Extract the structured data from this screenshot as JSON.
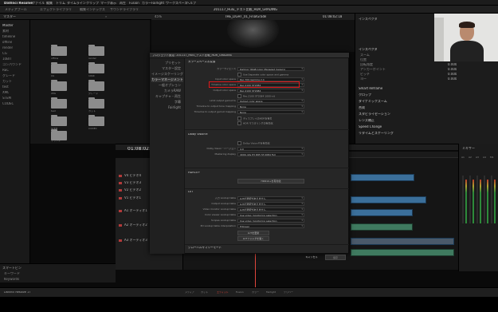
{
  "app": {
    "name": "DaVinci Resolve",
    "menus": [
      "ファイル",
      "編集",
      "トリム",
      "タイムライン",
      "クリップ",
      "マーク",
      "表示",
      "再生",
      "Fusion",
      "カラー",
      "Fairlight",
      "ワークスペース",
      "ヘルプ"
    ],
    "project_title": "201117_Hulu_テスト比較_HDR_GRADING"
  },
  "toolbar": {
    "items": [
      "メディアプール",
      "エフェクトライブラリ",
      "編集インデックス",
      "サウンドライブラリ"
    ],
    "viewer_label": "Timeline 1",
    "zoom": "45%"
  },
  "media_pool": {
    "header": "マスター",
    "bins": [
      "Master",
      "素材",
      "timeline",
      "offline",
      "render",
      "CG",
      "10BIT",
      "コンパウンド",
      "REC",
      "グレード",
      "カット",
      "test",
      "XML",
      "STEM",
      "CODEC"
    ],
    "clips": [
      "offline",
      "render",
      "CG",
      "10bit",
      "XML",
      "グレード",
      "test",
      "カット",
      "STEM",
      "CODEC",
      "サウンド",
      "テロップ",
      "タイムライン",
      "カラーグレード"
    ]
  },
  "viewer": {
    "filename": "THE_LIGHT_01_FinalGrade",
    "timecode": "01:08:02:18"
  },
  "inspector": {
    "header": "インスペクタ",
    "rows": [
      {
        "label": "ズーム",
        "value": "1.000"
      },
      {
        "label": "位置",
        "value": "0.000"
      },
      {
        "label": "回転角度",
        "value": "0.000"
      },
      {
        "label": "アンカーポイント",
        "value": "0.000"
      },
      {
        "label": "ピッチ",
        "value": "0.000"
      },
      {
        "label": "ヨー",
        "value": "0.000"
      }
    ],
    "sections": [
      "Smart Reframe",
      "クロップ",
      "ダイナミックズーム",
      "合成",
      "スタビライゼーション",
      "レンズ補正",
      "Speed Change",
      "リタイムとスケーリング"
    ]
  },
  "timeline": {
    "timecode": "01:08:02:18",
    "tracks": [
      "V4 ビデオ4",
      "V3 ビデオ3",
      "V2 ビデオ2",
      "V1 ビデオ1",
      "A1 オーディオ1",
      "A2 オーディオ2",
      "A3 オーディオ3"
    ],
    "mixer_label": "ミキサー",
    "mixer_channels": [
      "A1",
      "A2",
      "A3",
      "A4",
      "M1"
    ]
  },
  "left_bottom": {
    "header": "スマートビン",
    "items": [
      "キーワード",
      "Keywords"
    ]
  },
  "pages": [
    "メディア",
    "カット",
    "エディット",
    "Fusion",
    "カラー",
    "Fairlight",
    "デリバー"
  ],
  "footer": {
    "app_version": "DaVinci Resolve 17"
  },
  "dialog": {
    "title": "プロジェクト設定: 201117_Hulu_テスト比較_HDR_GRADING",
    "nav": [
      "プリセット",
      "マスター設定",
      "イメージスケーリング",
      "カラーマネージメント",
      "一般オプション",
      "カメラRAW",
      "キャプチャ・再生",
      "字幕",
      "Fairlight"
    ],
    "selected_nav": 3,
    "sections": {
      "color_space": "カラースペース＆変換",
      "dolby": "Dolby Vision®",
      "hdr10": "HDR10+",
      "lut": "LUT",
      "graphics": "グローバルサマリーモード"
    },
    "fields": [
      {
        "label": "カラーサイエンス",
        "value": "DaVinci YRGB Color Managed (legacy)"
      },
      {
        "label": "",
        "value": "Use Separate color space and gamma",
        "check": true
      },
      {
        "label": "Input color space",
        "value": "Rec.709 Gamma 2.4"
      },
      {
        "label": "Timeline color space",
        "value": "Rec.2100 ST2084"
      },
      {
        "label": "Output color space",
        "value": "Rec.2100 ST2084"
      },
      {
        "label": "",
        "value": "Rec.2100 ST2084 1000-nit",
        "check": true
      },
      {
        "label": "Limit output gamut to",
        "value": "Output color space"
      },
      {
        "label": "Timeline to output tone mapping",
        "value": "None"
      },
      {
        "label": "Timeline to output gamut mapping",
        "value": "None"
      }
    ],
    "checks": [
      "ディスプレイのHDRを有効",
      "HDR マスタリングの有効化"
    ],
    "dolby_checks": [
      "Dolby Vision®を有効化"
    ],
    "dolby_fields": [
      {
        "label": "Dolby Vision™バージョン",
        "value": "4.0"
      },
      {
        "label": "Mastering display",
        "value": "4000-nits P3 D65 ST.2084 Full"
      }
    ],
    "hdr10_button": "HDR10+を有効化",
    "lut_fields": [
      {
        "label": "入力 Lookup table",
        "value": "LUTの選択がありません"
      },
      {
        "label": "Output Lookup table",
        "value": "LUTの選択がありません"
      },
      {
        "label": "Video monitor Lookup table",
        "value": "LUTの選択がありません"
      },
      {
        "label": "Color viewer Lookup table",
        "value": "Use video monitoring selection"
      },
      {
        "label": "Scopes Lookup table",
        "value": "Use video monitoring selection"
      },
      {
        "label": "3D Lookup table interpolation",
        "value": "Trilinear"
      }
    ],
    "lut_checks": [
      "LUTを更新",
      "LUTフォルダを開く"
    ],
    "cancel_label": "キャンセル",
    "save_label": "保存"
  },
  "colors": {
    "highlight_box": "#e0191b",
    "playhead": "#e0463c",
    "clip_video": "#3b6f9a",
    "clip_audio": "#3f7a5f"
  }
}
